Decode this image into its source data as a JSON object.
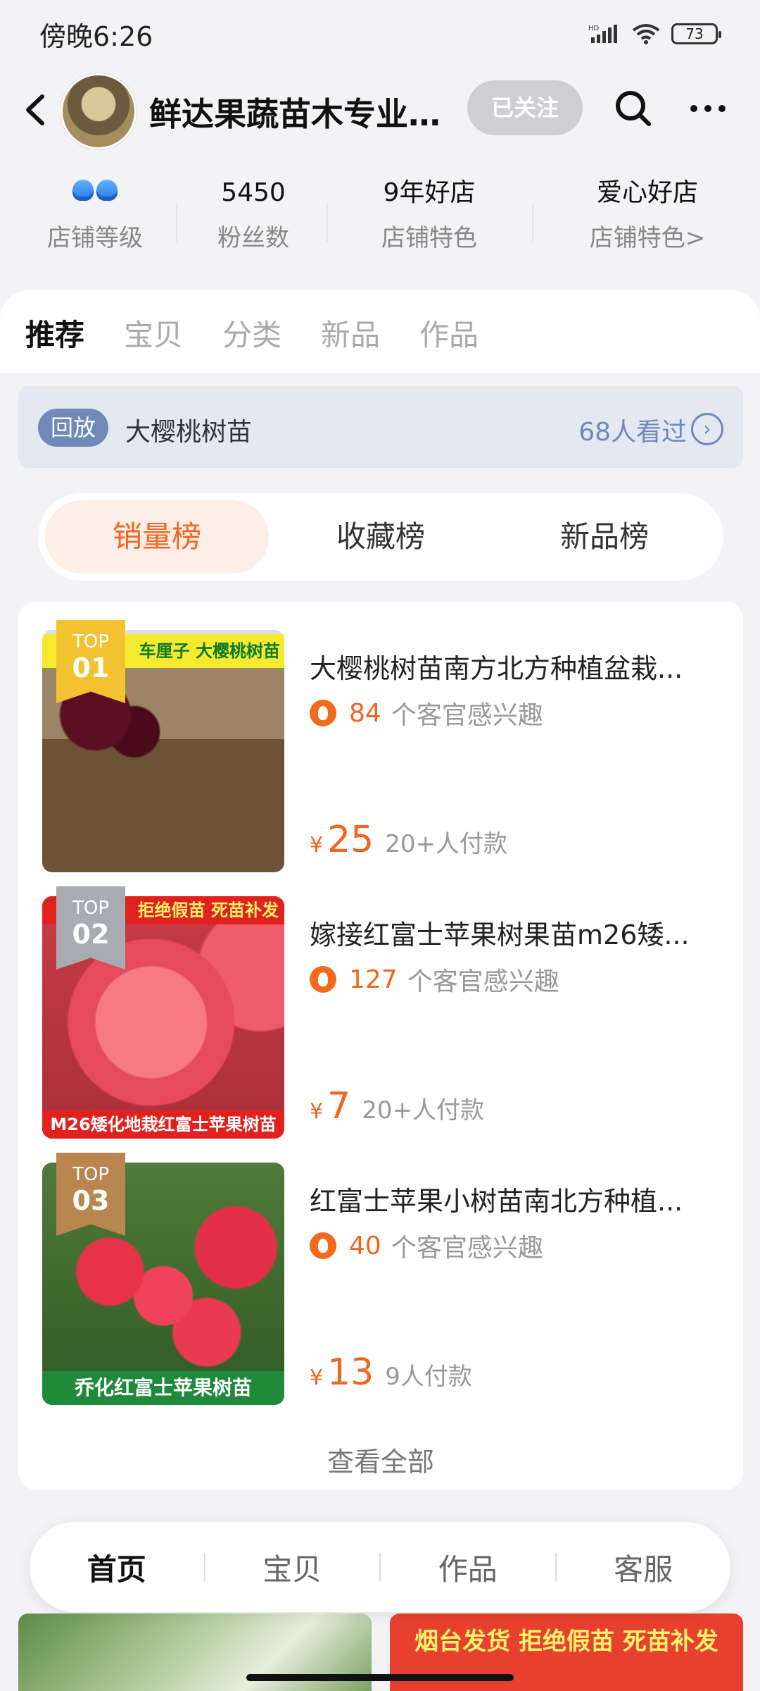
{
  "status_bar": {
    "time": "傍晚6:26",
    "hd": "HD",
    "battery": "73"
  },
  "header": {
    "shop_name": "鲜达果蔬苗木专业...",
    "follow_label": "已关注"
  },
  "stats": [
    {
      "value": "",
      "label": "店铺等级"
    },
    {
      "value": "5450",
      "label": "粉丝数"
    },
    {
      "value": "9年好店",
      "label": "店铺特色"
    },
    {
      "value": "爱心好店",
      "label": "店铺特色>"
    }
  ],
  "tabs": [
    {
      "label": "推荐",
      "active": true
    },
    {
      "label": "宝贝"
    },
    {
      "label": "分类"
    },
    {
      "label": "新品"
    },
    {
      "label": "作品"
    }
  ],
  "replay": {
    "badge": "回放",
    "title": "大樱桃树苗",
    "views": "68人看过"
  },
  "ranking_tabs": [
    {
      "label": "销量榜",
      "active": true
    },
    {
      "label": "收藏榜"
    },
    {
      "label": "新品榜"
    }
  ],
  "products": [
    {
      "rank_label": "TOP",
      "rank": "01",
      "badge_color": "#f2c230",
      "banner_text": "车厘子 大樱桃树苗",
      "name": "大樱桃树苗南方北方种植盆栽...",
      "interest_count": "84",
      "interest_text": "个客官感兴趣",
      "currency": "¥",
      "price": "25",
      "paid": "20+人付款"
    },
    {
      "rank_label": "TOP",
      "rank": "02",
      "badge_color": "#a9abb3",
      "banner_text": "拒绝假苗 死苗补发",
      "banner_text_bottom": "M26矮化地栽红富士苹果树苗",
      "name": "嫁接红富士苹果树果苗m26矮...",
      "interest_count": "127",
      "interest_text": "个客官感兴趣",
      "currency": "¥",
      "price": "7",
      "paid": "20+人付款"
    },
    {
      "rank_label": "TOP",
      "rank": "03",
      "badge_color": "#b8864e",
      "banner_text_bottom": "乔化红富士苹果树苗",
      "name": "红富士苹果小树苗南北方种植...",
      "interest_count": "40",
      "interest_text": "个客官感兴趣",
      "currency": "¥",
      "price": "13",
      "paid": "9人付款"
    }
  ],
  "see_all": "查看全部",
  "bottom_nav": [
    {
      "label": "首页",
      "active": true
    },
    {
      "label": "宝贝"
    },
    {
      "label": "作品"
    },
    {
      "label": "客服"
    }
  ],
  "peek": {
    "right_text": "烟台发货 拒绝假苗 死苗补发"
  }
}
